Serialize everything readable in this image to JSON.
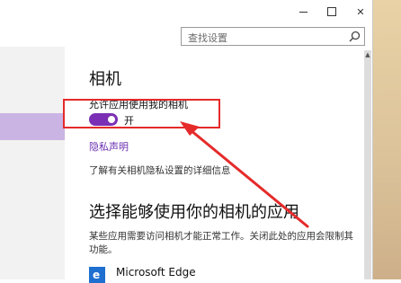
{
  "window": {
    "minimize_icon": "minimize-icon",
    "maximize_icon": "maximize-icon",
    "close_icon": "close-icon",
    "close_label": "✕"
  },
  "search": {
    "placeholder": "查找设置",
    "icon": "search-icon"
  },
  "main": {
    "title": "相机",
    "camera_access_label": "允许应用使用我的相机",
    "toggle_state": "开",
    "toggle_on": true,
    "toggle_color": "#7b2fb5",
    "privacy_link": "隐私声明",
    "learn_more": "了解有关相机隐私设置的详细信息",
    "section_title": "选择能够使用你的相机的应用",
    "section_description": "某些应用需要访问相机才能正常工作。关闭此处的应用会限制其功能。",
    "apps": [
      {
        "name": "Microsoft Edge",
        "icon": "edge-icon"
      }
    ]
  },
  "annotation": {
    "color": "#e52a2a"
  }
}
